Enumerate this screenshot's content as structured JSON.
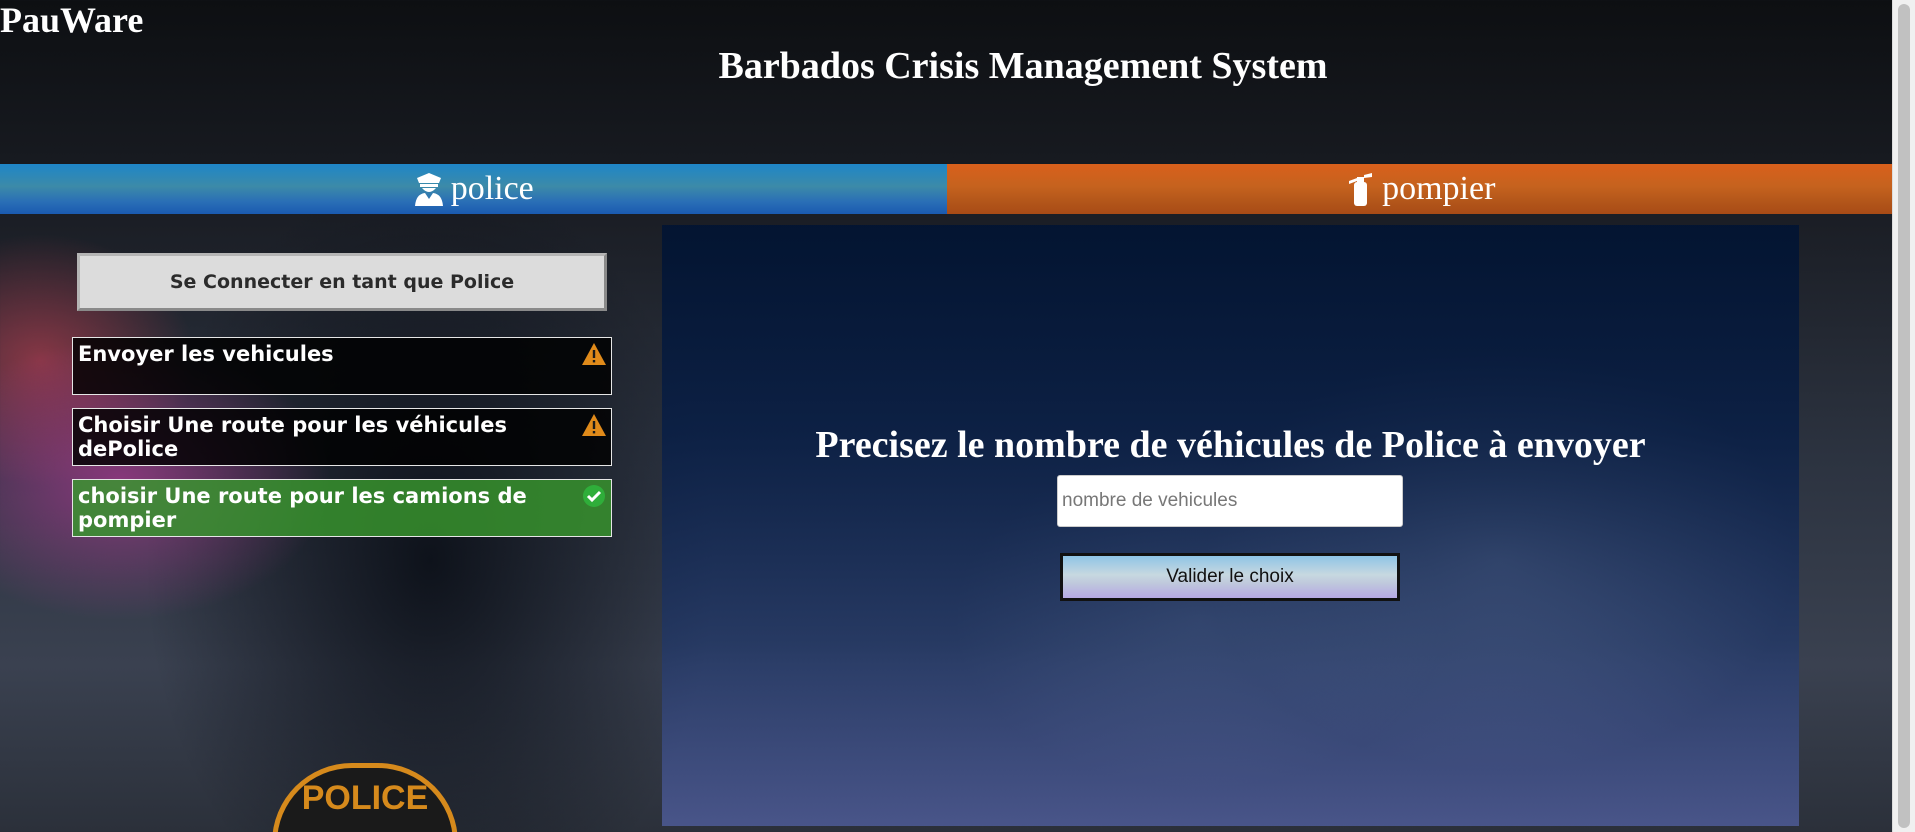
{
  "header": {
    "brand": "PauWare",
    "title": "Barbados Crisis Management System"
  },
  "tabs": [
    {
      "label": "police",
      "icon": "police-officer-icon",
      "color": "#1e86c8"
    },
    {
      "label": "pompier",
      "icon": "fire-extinguisher-icon",
      "color": "#d9601c"
    }
  ],
  "sidebar": {
    "connect_label": "Se Connecter en tant que Police",
    "steps": [
      {
        "label": "Envoyer les vehicules",
        "status": "warning",
        "status_icon": "warning-icon"
      },
      {
        "label": "Choisir Une route pour les véhicules dePolice",
        "status": "warning",
        "status_icon": "warning-icon"
      },
      {
        "label": "choisir Une route pour les camions de pompier",
        "status": "done",
        "status_icon": "check-circle-icon"
      }
    ]
  },
  "panel": {
    "heading": "Precisez le nombre de véhicules de Police à envoyer",
    "input_placeholder": "nombre de vehicules",
    "input_value": "",
    "validate_label": "Valider le choix"
  },
  "background": {
    "badge_text": "POLICE"
  },
  "colors": {
    "warning": "#e08a1a",
    "done": "#2fae3a",
    "police_tab": "#1e86c8",
    "pompier_tab": "#d9601c"
  }
}
